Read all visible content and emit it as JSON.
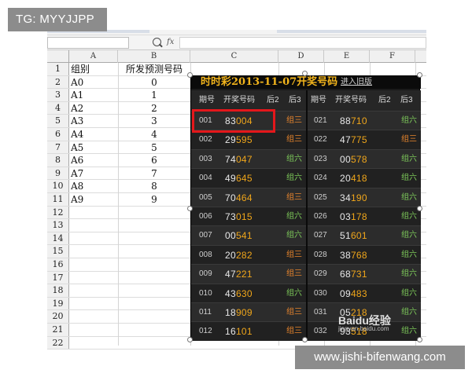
{
  "tags": {
    "top_left": "TG: MYYJJPP",
    "bottom_right": "www.jishi-bifenwang.com"
  },
  "formula_bar": {
    "fx_label": "fx"
  },
  "columns": [
    "A",
    "B",
    "C",
    "D",
    "E",
    "F"
  ],
  "row_numbers": [
    "1",
    "2",
    "3",
    "4",
    "5",
    "6",
    "7",
    "8",
    "9",
    "10",
    "11",
    "12",
    "13",
    "14",
    "15",
    "16",
    "17",
    "18",
    "19",
    "20",
    "21",
    "22"
  ],
  "cells": {
    "a": [
      "组别",
      "A0",
      "A1",
      "A2",
      "A3",
      "A4",
      "A5",
      "A6",
      "A7",
      "A8",
      "A9"
    ],
    "b": [
      "所发预测号码",
      "0",
      "1",
      "2",
      "3",
      "4",
      "5",
      "6",
      "7",
      "8",
      "9"
    ]
  },
  "lottery": {
    "title": "时时彩2013-11-07开奖号码",
    "old_link": "进入旧版",
    "headers": {
      "qihao": "期号",
      "kaijiang": "开奖号码",
      "hou2": "后2",
      "hou3": "后3"
    },
    "left": [
      {
        "qi": "001",
        "pre": "83",
        "hl": "004",
        "grp": "组三",
        "type": "g3"
      },
      {
        "qi": "002",
        "pre": "29",
        "hl": "595",
        "grp": "组三",
        "type": "g3"
      },
      {
        "qi": "003",
        "pre": "74",
        "hl": "047",
        "grp": "组六",
        "type": "g6"
      },
      {
        "qi": "004",
        "pre": "49",
        "hl": "645",
        "grp": "组六",
        "type": "g6"
      },
      {
        "qi": "005",
        "pre": "70",
        "hl": "464",
        "grp": "组三",
        "type": "g3"
      },
      {
        "qi": "006",
        "pre": "73",
        "hl": "015",
        "grp": "组六",
        "type": "g6"
      },
      {
        "qi": "007",
        "pre": "00",
        "hl": "541",
        "grp": "组六",
        "type": "g6"
      },
      {
        "qi": "008",
        "pre": "20",
        "hl": "282",
        "grp": "组三",
        "type": "g3"
      },
      {
        "qi": "009",
        "pre": "47",
        "hl": "221",
        "grp": "组三",
        "type": "g3"
      },
      {
        "qi": "010",
        "pre": "43",
        "hl": "630",
        "grp": "组六",
        "type": "g6"
      },
      {
        "qi": "011",
        "pre": "18",
        "hl": "909",
        "grp": "组三",
        "type": "g3"
      },
      {
        "qi": "012",
        "pre": "16",
        "hl": "101",
        "grp": "组三",
        "type": "g3"
      }
    ],
    "right": [
      {
        "qi": "021",
        "pre": "88",
        "hl": "710",
        "grp": "组六",
        "type": "g6"
      },
      {
        "qi": "022",
        "pre": "47",
        "hl": "775",
        "grp": "组三",
        "type": "g3"
      },
      {
        "qi": "023",
        "pre": "00",
        "hl": "578",
        "grp": "组六",
        "type": "g6"
      },
      {
        "qi": "024",
        "pre": "20",
        "hl": "418",
        "grp": "组六",
        "type": "g6"
      },
      {
        "qi": "025",
        "pre": "34",
        "hl": "190",
        "grp": "组六",
        "type": "g6"
      },
      {
        "qi": "026",
        "pre": "03",
        "hl": "178",
        "grp": "组六",
        "type": "g6"
      },
      {
        "qi": "027",
        "pre": "51",
        "hl": "601",
        "grp": "组六",
        "type": "g6"
      },
      {
        "qi": "028",
        "pre": "38",
        "hl": "768",
        "grp": "组六",
        "type": "g6"
      },
      {
        "qi": "029",
        "pre": "68",
        "hl": "731",
        "grp": "组六",
        "type": "g6"
      },
      {
        "qi": "030",
        "pre": "09",
        "hl": "483",
        "grp": "组六",
        "type": "g6"
      },
      {
        "qi": "031",
        "pre": "05",
        "hl": "218",
        "grp": "组六",
        "type": "g6"
      },
      {
        "qi": "032",
        "pre": "93",
        "hl": "518",
        "grp": "组六",
        "type": "g6"
      }
    ]
  },
  "baidu_watermark": {
    "logo": "Baidu经验",
    "url": "jingyan.baidu.com"
  },
  "colors": {
    "highlight": "#f0a61a",
    "group6": "#7ecb5a",
    "group3": "#e8852c",
    "redbox": "#e4171b"
  }
}
